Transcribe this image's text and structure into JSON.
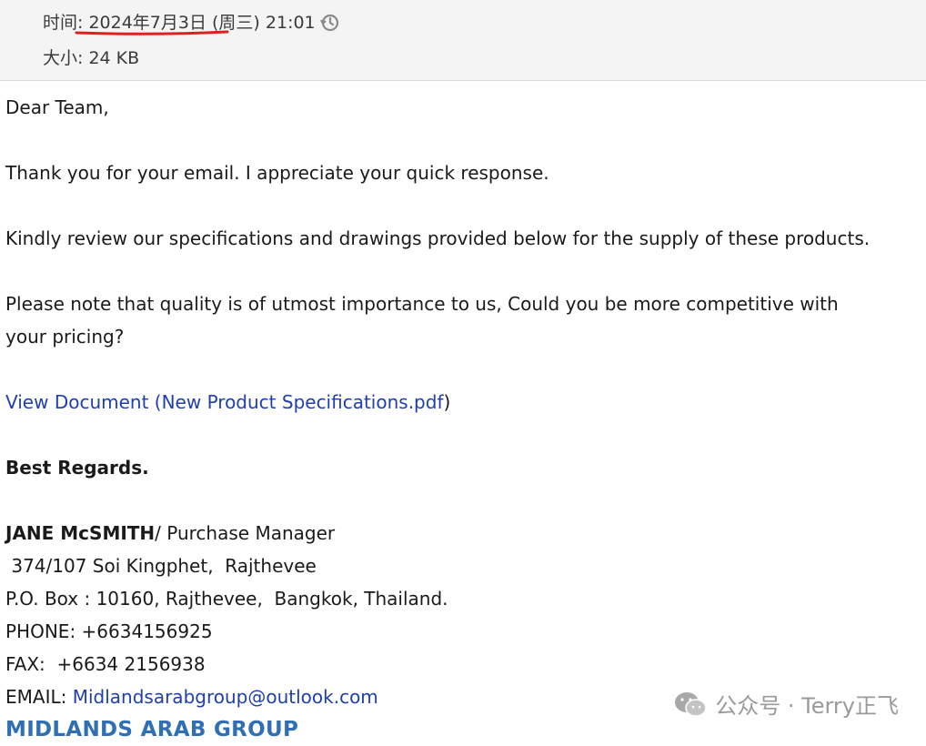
{
  "header": {
    "time_label": "时间:",
    "time_value": "2024年7月3日 (周三) 21:01",
    "size_label": "大小:",
    "size_value": "24 KB",
    "underline_color": "#e02020"
  },
  "email": {
    "greeting": "Dear Team,",
    "line1": "Thank you for your email. I appreciate your quick response.",
    "line2": "Kindly review our specifications and drawings provided below for the supply of these products.",
    "line3": "Please note that quality is of utmost importance to us, Could you be more competitive with your pricing?",
    "link_text": "View Document (New Product Specifications.pdf",
    "link_close": ")",
    "regards": "Best Regards.",
    "signature": {
      "name": "JANE McSMITH",
      "title": "/ Purchase Manager",
      "address1": " 374/107 Soi Kingphet,  Rajthevee",
      "address2": "P.O. Box : 10160, Rajthevee,  Bangkok, Thailand.",
      "phone": "PHONE: +6634156925",
      "fax": "FAX:  +6634 2156938",
      "email_label": "EMAIL: ",
      "email_value": "Midlandsarabgroup@outlook.com",
      "company": "MIDLANDS ARAB GROUP"
    }
  },
  "watermark": {
    "text": "公众号 · Terry正飞",
    "icon": "wechat-icon"
  }
}
